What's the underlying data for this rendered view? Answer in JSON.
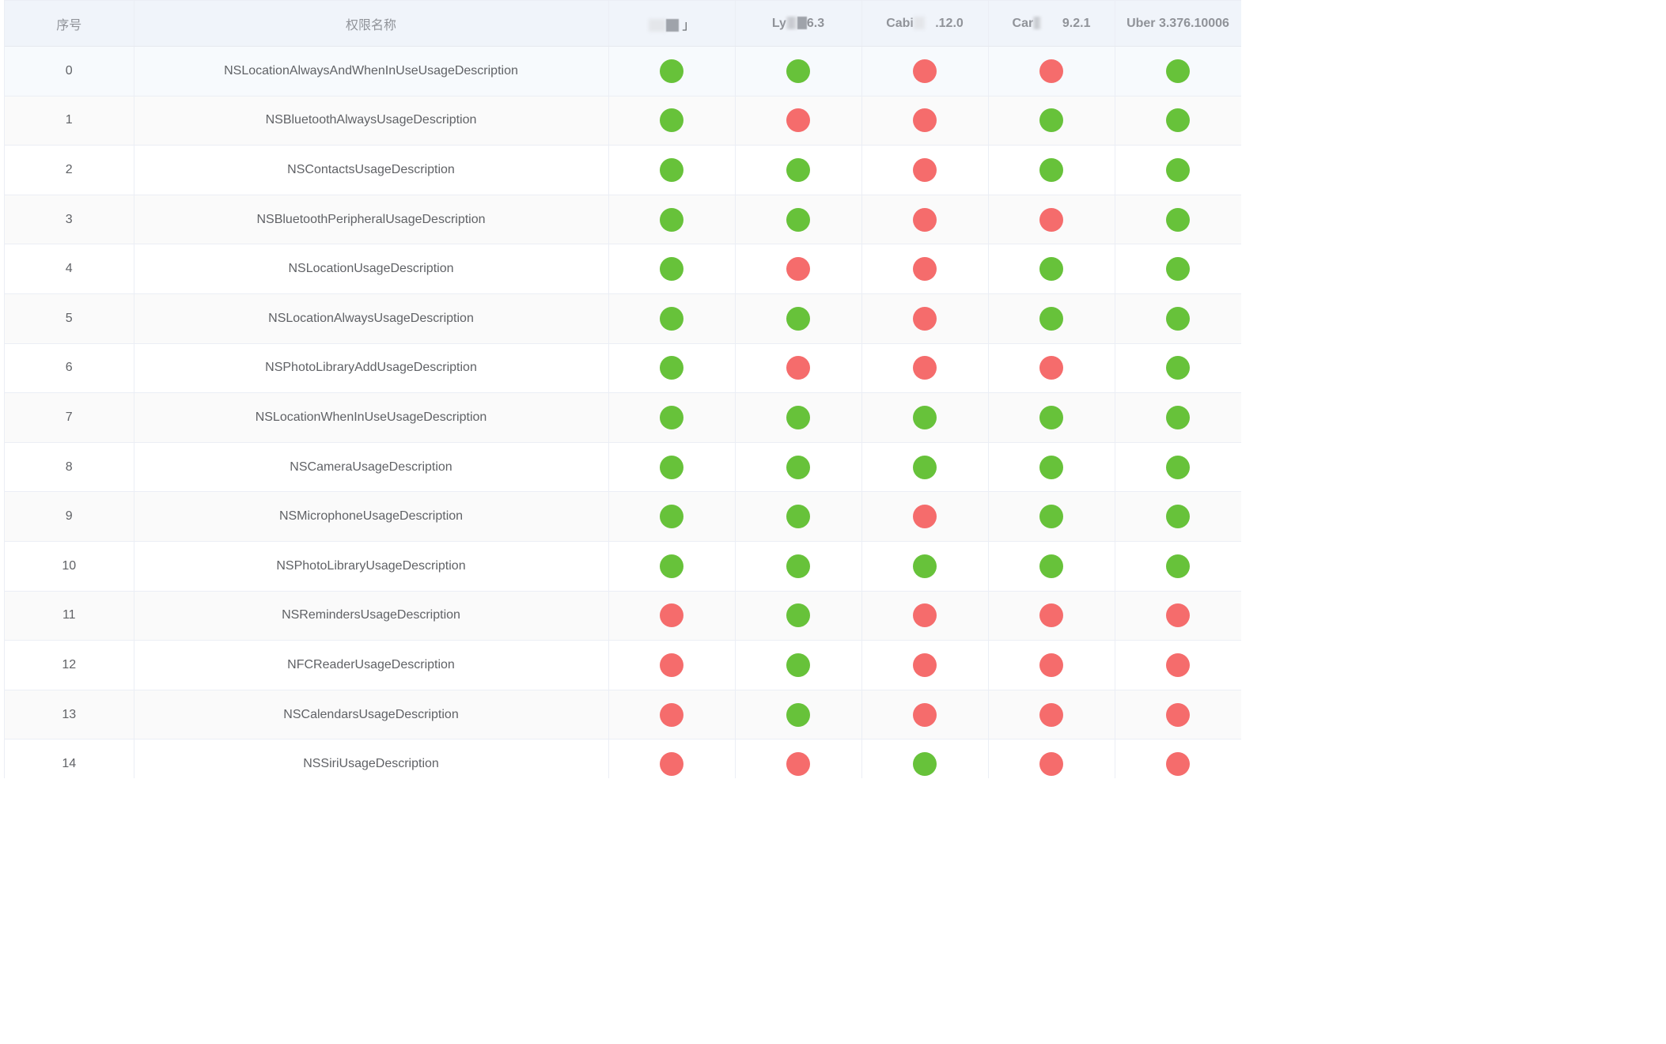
{
  "colors": {
    "enabled": "#67c23a",
    "disabled": "#f56c6c"
  },
  "header": {
    "index_label": "序号",
    "name_label": "权限名称",
    "apps": [
      {
        "pre": "",
        "post": "」",
        "obscured": true
      },
      {
        "pre": "Ly",
        "post": "6.3",
        "obscured": true
      },
      {
        "pre": "Cabi",
        "post": ".12.0",
        "obscured": true
      },
      {
        "pre": "Car",
        "post": "9.2.1",
        "obscured": true
      },
      {
        "pre": "Uber 3.376.10006",
        "post": "",
        "obscured": false
      }
    ]
  },
  "rows": [
    {
      "index": "0",
      "name": "NSLocationAlwaysAndWhenInUseUsageDescription",
      "status": [
        true,
        true,
        false,
        false,
        true
      ]
    },
    {
      "index": "1",
      "name": "NSBluetoothAlwaysUsageDescription",
      "status": [
        true,
        false,
        false,
        true,
        true
      ]
    },
    {
      "index": "2",
      "name": "NSContactsUsageDescription",
      "status": [
        true,
        true,
        false,
        true,
        true
      ]
    },
    {
      "index": "3",
      "name": "NSBluetoothPeripheralUsageDescription",
      "status": [
        true,
        true,
        false,
        false,
        true
      ]
    },
    {
      "index": "4",
      "name": "NSLocationUsageDescription",
      "status": [
        true,
        false,
        false,
        true,
        true
      ]
    },
    {
      "index": "5",
      "name": "NSLocationAlwaysUsageDescription",
      "status": [
        true,
        true,
        false,
        true,
        true
      ]
    },
    {
      "index": "6",
      "name": "NSPhotoLibraryAddUsageDescription",
      "status": [
        true,
        false,
        false,
        false,
        true
      ]
    },
    {
      "index": "7",
      "name": "NSLocationWhenInUseUsageDescription",
      "status": [
        true,
        true,
        true,
        true,
        true
      ]
    },
    {
      "index": "8",
      "name": "NSCameraUsageDescription",
      "status": [
        true,
        true,
        true,
        true,
        true
      ]
    },
    {
      "index": "9",
      "name": "NSMicrophoneUsageDescription",
      "status": [
        true,
        true,
        false,
        true,
        true
      ]
    },
    {
      "index": "10",
      "name": "NSPhotoLibraryUsageDescription",
      "status": [
        true,
        true,
        true,
        true,
        true
      ]
    },
    {
      "index": "11",
      "name": "NSRemindersUsageDescription",
      "status": [
        false,
        true,
        false,
        false,
        false
      ]
    },
    {
      "index": "12",
      "name": "NFCReaderUsageDescription",
      "status": [
        false,
        true,
        false,
        false,
        false
      ]
    },
    {
      "index": "13",
      "name": "NSCalendarsUsageDescription",
      "status": [
        false,
        true,
        false,
        false,
        false
      ]
    },
    {
      "index": "14",
      "name": "NSSiriUsageDescription",
      "status": [
        false,
        false,
        true,
        false,
        false
      ]
    }
  ]
}
